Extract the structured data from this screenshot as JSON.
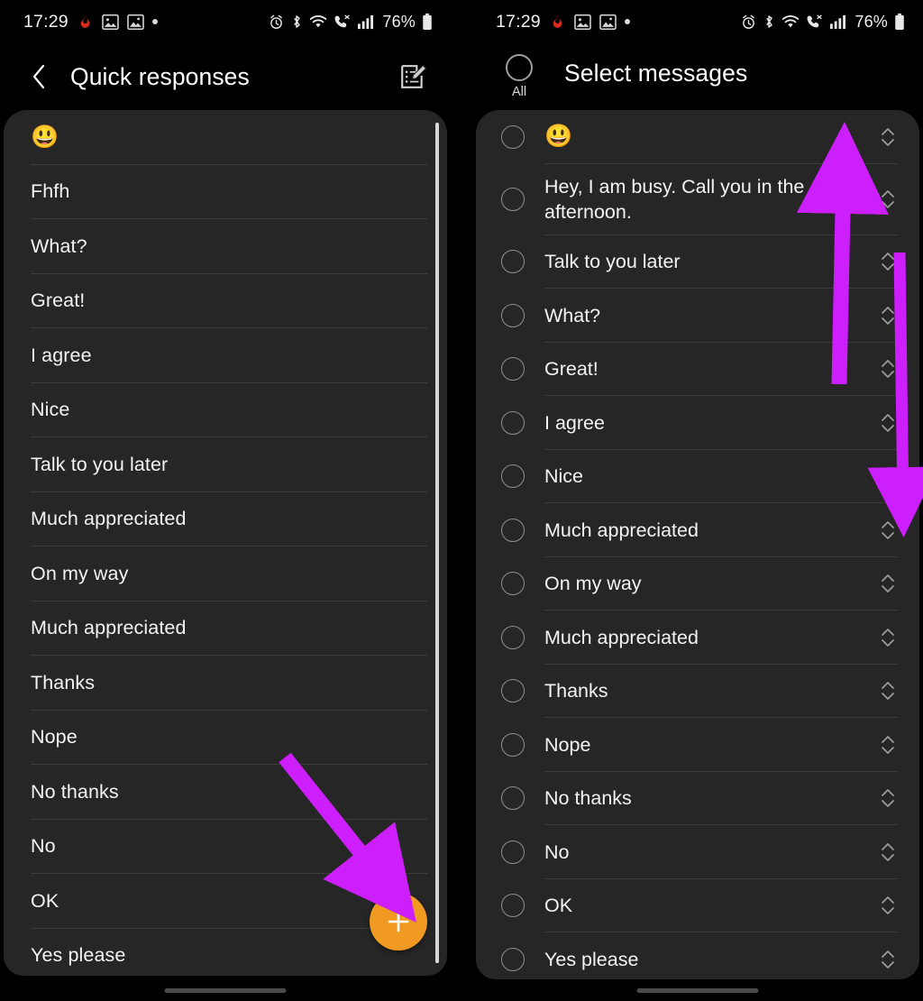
{
  "status_bar": {
    "time": "17:29",
    "battery_percent": "76%",
    "icons_left": [
      "flame-app-icon",
      "image-icon",
      "gallery-icon",
      "dot-icon"
    ],
    "icons_right": [
      "alarm-icon",
      "bluetooth-icon",
      "wifi-icon",
      "volte-call-icon",
      "signal-bars-icon",
      "battery-icon"
    ]
  },
  "left_screen": {
    "header": {
      "back_icon": "back-arrow-icon",
      "title": "Quick responses",
      "edit_icon": "edit-compose-icon"
    },
    "items": [
      {
        "text": "😃",
        "is_emoji": true
      },
      {
        "text": "Fhfh",
        "is_emoji": false
      },
      {
        "text": "What?",
        "is_emoji": false
      },
      {
        "text": "Great!",
        "is_emoji": false
      },
      {
        "text": "I agree",
        "is_emoji": false
      },
      {
        "text": "Nice",
        "is_emoji": false
      },
      {
        "text": "Talk to you later",
        "is_emoji": false
      },
      {
        "text": "Much appreciated",
        "is_emoji": false
      },
      {
        "text": "On my way",
        "is_emoji": false
      },
      {
        "text": "Much appreciated",
        "is_emoji": false
      },
      {
        "text": "Thanks",
        "is_emoji": false
      },
      {
        "text": "Nope",
        "is_emoji": false
      },
      {
        "text": "No thanks",
        "is_emoji": false
      },
      {
        "text": "No",
        "is_emoji": false
      },
      {
        "text": "OK",
        "is_emoji": false
      },
      {
        "text": "Yes please",
        "is_emoji": false
      }
    ],
    "fab": {
      "icon": "plus-icon",
      "color": "#f09a22"
    }
  },
  "right_screen": {
    "header": {
      "select_all_label": "All",
      "title": "Select messages"
    },
    "items": [
      {
        "text": "😃",
        "is_emoji": true,
        "tall": false
      },
      {
        "text": "Hey, I am busy. Call you in the afternoon.",
        "is_emoji": false,
        "tall": true
      },
      {
        "text": "Talk to you later",
        "is_emoji": false,
        "tall": false
      },
      {
        "text": "What?",
        "is_emoji": false,
        "tall": false
      },
      {
        "text": "Great!",
        "is_emoji": false,
        "tall": false
      },
      {
        "text": "I agree",
        "is_emoji": false,
        "tall": false
      },
      {
        "text": "Nice",
        "is_emoji": false,
        "tall": false
      },
      {
        "text": "Much appreciated",
        "is_emoji": false,
        "tall": false
      },
      {
        "text": "On my way",
        "is_emoji": false,
        "tall": false
      },
      {
        "text": "Much appreciated",
        "is_emoji": false,
        "tall": false
      },
      {
        "text": "Thanks",
        "is_emoji": false,
        "tall": false
      },
      {
        "text": "Nope",
        "is_emoji": false,
        "tall": false
      },
      {
        "text": "No thanks",
        "is_emoji": false,
        "tall": false
      },
      {
        "text": "No",
        "is_emoji": false,
        "tall": false
      },
      {
        "text": "OK",
        "is_emoji": false,
        "tall": false
      },
      {
        "text": "Yes please",
        "is_emoji": false,
        "tall": false
      }
    ]
  },
  "annotations": {
    "color": "#cc1ffb",
    "arrows": [
      {
        "name": "arrow-to-add-button",
        "screen": "left"
      },
      {
        "name": "arrow-up-reorder",
        "screen": "right"
      },
      {
        "name": "arrow-down-reorder",
        "screen": "right"
      }
    ]
  }
}
